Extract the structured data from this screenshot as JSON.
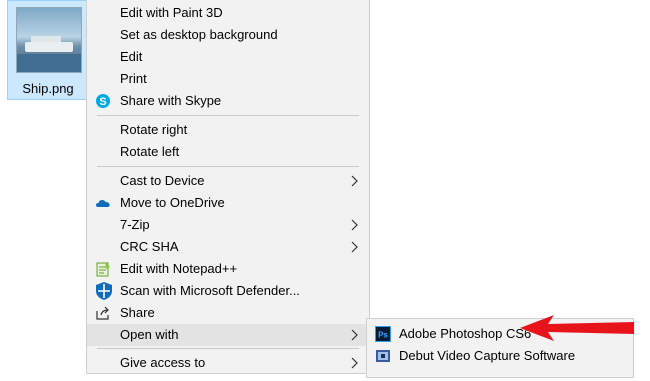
{
  "desktop": {
    "file_name": "Ship.png"
  },
  "context_menu": {
    "items": [
      {
        "label": "Edit with Paint 3D"
      },
      {
        "label": "Set as desktop background"
      },
      {
        "label": "Edit"
      },
      {
        "label": "Print"
      },
      {
        "label": "Share with Skype",
        "icon": "skype-icon"
      },
      {
        "label": "Rotate right"
      },
      {
        "label": "Rotate left"
      },
      {
        "label": "Cast to Device",
        "submenu": true
      },
      {
        "label": "Move to OneDrive",
        "icon": "onedrive-icon"
      },
      {
        "label": "7-Zip",
        "submenu": true
      },
      {
        "label": "CRC SHA",
        "submenu": true
      },
      {
        "label": "Edit with Notepad++",
        "icon": "notepad-plus-plus-icon"
      },
      {
        "label": "Scan with Microsoft Defender...",
        "icon": "defender-shield-icon"
      },
      {
        "label": "Share",
        "icon": "share-icon"
      },
      {
        "label": "Open with",
        "submenu": true,
        "highlighted": true
      },
      {
        "label": "Give access to",
        "submenu": true
      }
    ]
  },
  "open_with_submenu": {
    "items": [
      {
        "label": "Adobe Photoshop CS6",
        "icon": "photoshop-icon"
      },
      {
        "label": "Debut Video Capture Software",
        "icon": "debut-icon"
      }
    ]
  },
  "colors": {
    "menu_bg": "#f2f2f2",
    "highlight": "#e3e3e3",
    "selection": "#cce8ff",
    "annotation_arrow": "#e8141c"
  }
}
